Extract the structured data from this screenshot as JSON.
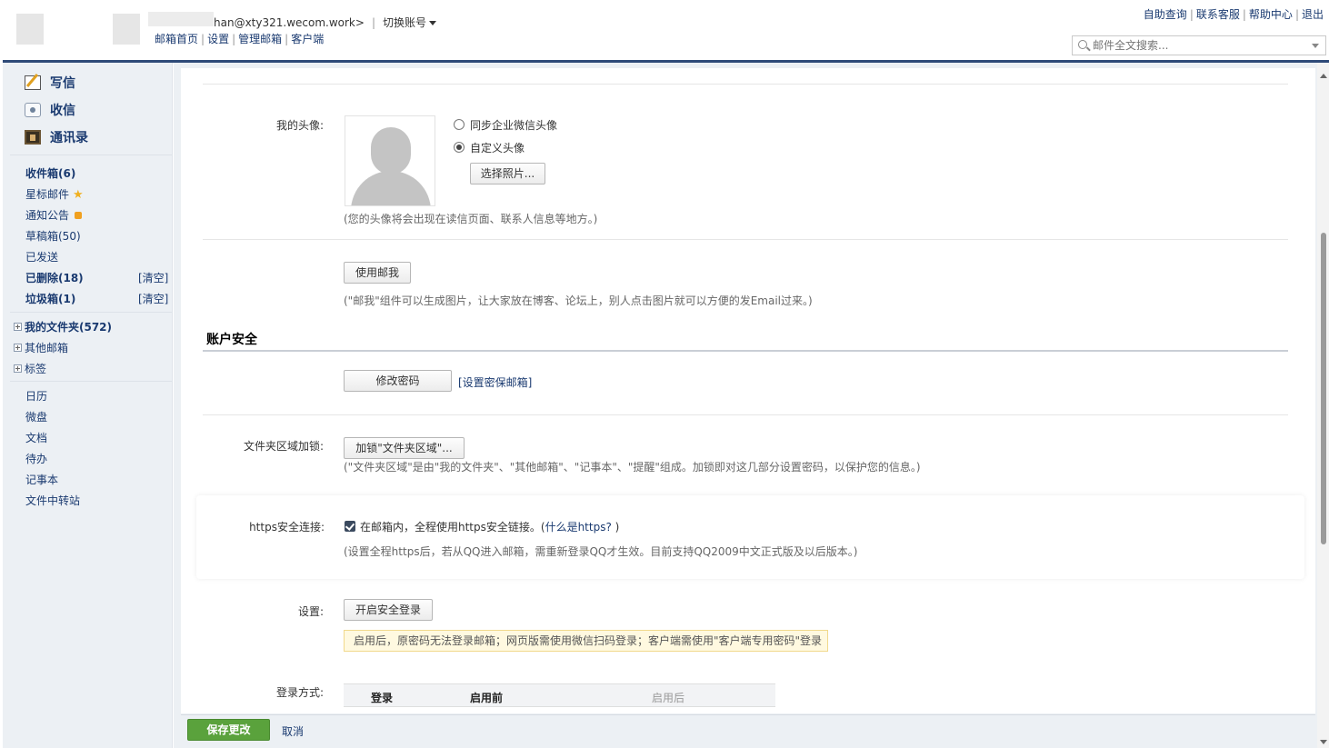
{
  "header": {
    "account_email": "han@xty321.wecom.work>",
    "separator": "|",
    "switch_account": "切换账号",
    "nav_links": [
      "邮箱首页",
      "设置",
      "管理邮箱",
      "客户端"
    ],
    "top_links": [
      "自助查询",
      "联系客服",
      "帮助中心",
      "退出"
    ],
    "search_placeholder": "邮件全文搜索..."
  },
  "sidebar": {
    "compose": "写信",
    "receive": "收信",
    "contacts": "通讯录",
    "folders": [
      {
        "label": "收件箱(6)",
        "bold": true
      },
      {
        "label": "星标邮件",
        "bold": false
      },
      {
        "label": "通知公告",
        "bold": false
      },
      {
        "label": "草稿箱(50)",
        "bold": false
      },
      {
        "label": "已发送",
        "bold": false
      },
      {
        "label": "已删除(18)",
        "bold": true,
        "action": "[清空]"
      },
      {
        "label": "垃圾箱(1)",
        "bold": true,
        "action": "[清空]"
      }
    ],
    "tree": [
      {
        "label": "我的文件夹(572)",
        "bold": true
      },
      {
        "label": "其他邮箱",
        "bold": false
      },
      {
        "label": "标签",
        "bold": false
      }
    ],
    "apps": [
      "日历",
      "微盘",
      "文档",
      "待办",
      "记事本",
      "文件中转站"
    ]
  },
  "avatar": {
    "label": "我的头像:",
    "option_sync": "同步企业微信头像",
    "option_custom": "自定义头像",
    "select_button": "选择照片...",
    "hint": "(您的头像将会出现在读信页面、联系人信息等地方。)"
  },
  "mailme": {
    "button": "使用邮我",
    "hint": "(\"邮我\"组件可以生成图片，让大家放在博客、论坛上，别人点击图片就可以方便的发Email过来。)"
  },
  "security": {
    "title": "账户安全",
    "change_password": "修改密码",
    "set_security_mail": "[设置密保邮箱]",
    "folder_lock_label": "文件夹区域加锁:",
    "folder_lock_button": "加锁\"文件夹区域\"...",
    "folder_lock_hint": "(\"文件夹区域\"是由\"我的文件夹\"、\"其他邮箱\"、\"记事本\"、\"提醒\"组成。加锁即对这几部分设置密码，以保护您的信息。)",
    "https_label": "https安全连接:",
    "https_checkbox_text": "在邮箱内，全程使用https安全链接。(",
    "https_link": "什么是https?",
    "https_close": " )",
    "https_hint": "(设置全程https后，若从QQ进入邮箱，需重新登录QQ才生效。目前支持QQ2009中文正式版及以后版本。)",
    "settings_label": "设置:",
    "secure_login_button": "开启安全登录",
    "warning": "启用后，原密码无法登录邮箱；网页版需使用微信扫码登录；客户端需使用\"客户端专用密码\"登录",
    "login_method_label": "登录方式:",
    "table_headers": [
      "登录",
      "启用前",
      "启用后"
    ]
  },
  "footer": {
    "save": "保存更改",
    "cancel": "取消"
  }
}
